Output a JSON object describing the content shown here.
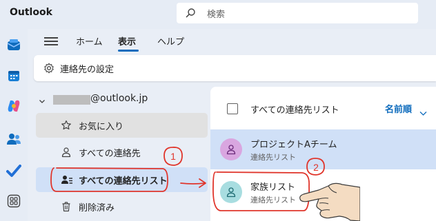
{
  "app": {
    "title": "Outlook"
  },
  "search": {
    "placeholder": "検索"
  },
  "ribbon": {
    "tabs": [
      {
        "label": "ホーム"
      },
      {
        "label": "表示"
      },
      {
        "label": "ヘルプ"
      }
    ]
  },
  "toolbar": {
    "contact_settings": "連絡先の設定"
  },
  "nav": {
    "account": "@outlook.jp",
    "items": [
      {
        "label": "お気に入り"
      },
      {
        "label": "すべての連絡先"
      },
      {
        "label": "すべての連絡先リスト"
      },
      {
        "label": "削除済み"
      }
    ]
  },
  "list": {
    "header": "すべての連絡先リスト",
    "sort": "名前順",
    "rows": [
      {
        "title": "プロジェクトAチーム",
        "subtitle": "連絡先リスト"
      },
      {
        "title": "家族リスト",
        "subtitle": "連絡先リスト"
      }
    ]
  },
  "annotations": {
    "step1": "1",
    "step2": "2"
  },
  "colors": {
    "accent": "#0f6cbd",
    "annotation": "#e0352b",
    "selected": "#d0e0f7"
  }
}
